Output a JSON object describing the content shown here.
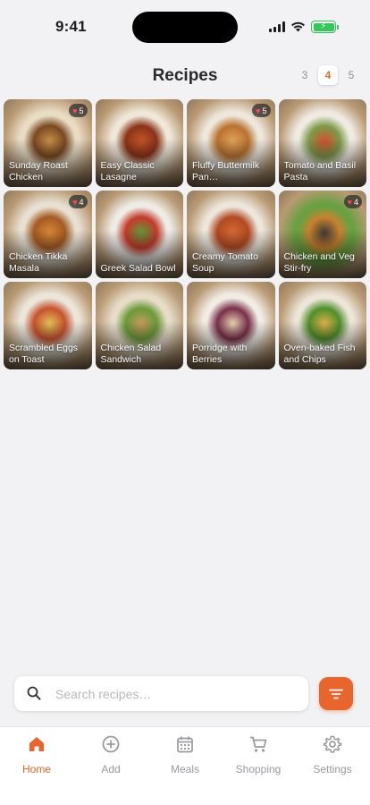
{
  "status_bar": {
    "time": "9:41"
  },
  "header": {
    "title": "Recipes",
    "pages": [
      "3",
      "4",
      "5"
    ],
    "active_page": "4"
  },
  "recipes": [
    {
      "title": "Sunday Roast Chicken",
      "favorites": "5",
      "colors": [
        "#c98f4a",
        "#7a4a20",
        "#e9dcc4"
      ]
    },
    {
      "title": "Easy Classic Lasagne",
      "favorites": "",
      "colors": [
        "#c2552b",
        "#8a3418",
        "#efe7d8"
      ]
    },
    {
      "title": "Fluffy Buttermilk Pan…",
      "favorites": "5",
      "colors": [
        "#e0a45a",
        "#b9722f",
        "#eee7dc"
      ]
    },
    {
      "title": "Tomato and Basil Pasta",
      "favorites": "",
      "colors": [
        "#d4502f",
        "#7d9a4a",
        "#f0ebe2"
      ]
    },
    {
      "title": "Chicken Tikka Masala",
      "favorites": "4",
      "colors": [
        "#d88a3a",
        "#a45a22",
        "#e8e0d2"
      ]
    },
    {
      "title": "Greek Salad Bowl",
      "favorites": "",
      "colors": [
        "#5f9a3c",
        "#c43a2a",
        "#eeece6"
      ]
    },
    {
      "title": "Creamy Tomato Soup",
      "favorites": "",
      "colors": [
        "#d56a35",
        "#b24a22",
        "#ece6db"
      ]
    },
    {
      "title": "Chicken and Veg Stir-fry",
      "favorites": "4",
      "colors": [
        "#3e3a36",
        "#c9822f",
        "#6aa042"
      ]
    },
    {
      "title": "Scrambled Eggs on Toast",
      "favorites": "",
      "colors": [
        "#e6c25a",
        "#c6522f",
        "#ece6da"
      ]
    },
    {
      "title": "Chicken Salad Sandwich",
      "favorites": "",
      "colors": [
        "#c89a5e",
        "#6b9a3a",
        "#e7dcc8"
      ]
    },
    {
      "title": "Porridge with Berries",
      "favorites": "",
      "colors": [
        "#e8d6b4",
        "#7a2f4a",
        "#f1ece4"
      ]
    },
    {
      "title": "Oven-baked Fish and Chips",
      "favorites": "",
      "colors": [
        "#e2b04a",
        "#4f8f2c",
        "#ece5d8"
      ]
    }
  ],
  "search": {
    "placeholder": "Search recipes…",
    "value": ""
  },
  "tabs": [
    {
      "label": "Home",
      "icon": "house-icon",
      "active": true
    },
    {
      "label": "Add",
      "icon": "plus-circle-icon",
      "active": false
    },
    {
      "label": "Meals",
      "icon": "calendar-icon",
      "active": false
    },
    {
      "label": "Shopping",
      "icon": "cart-icon",
      "active": false
    },
    {
      "label": "Settings",
      "icon": "gear-icon",
      "active": false
    }
  ],
  "colors": {
    "accent": "#e8652d",
    "favorite": "#ff4a5c",
    "battery": "#34c759"
  }
}
